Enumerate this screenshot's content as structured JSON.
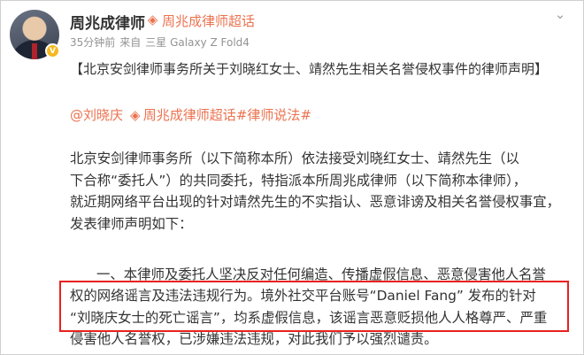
{
  "post": {
    "author": "周兆成律师",
    "topic_icon": "diamond-topic-icon",
    "topic": "周兆成律师超话",
    "time": "35分钟前",
    "source_prefix": "来自",
    "device": "三星 Galaxy Z Fold4",
    "menu_icon": "chevron-down-icon",
    "verified_icon": "v-verified-icon",
    "verified_glyph": "V",
    "title": "【北京安剑律师事务所关于刘晓红女士、靖然先生相关名誉侵权事件的律师声明】",
    "mention": "@刘晓庆",
    "topic2": "周兆成律师超话",
    "hashtag": "#律师说法#",
    "paragraph1": [
      "北京安剑律师事务所（以下简称本所）依法接受刘晓红女士、靖然先生（以",
      "下合称“委托人”）的共同委托，特指派本所周兆成律师（以下简称本律师），",
      "就近期网络平台出现的针对靖然先生的不实指认、恶意诽谤及相关名誉侵权事宜，",
      "发表律师声明如下："
    ],
    "paragraph2": [
      "一、本律师及委托人坚决反对任何编造、传播虚假信息、恶意侵害他人名誉",
      "权的网络谣言及违法违规行为。境外社交平台账号“Daniel Fang” 发布的针对",
      "“刘晓庆女士的死亡谣言”，均系虚假信息，该谣言恶意贬损他人人格尊严、严重",
      "侵害他人名誉权，已涉嫌违法违规，对此我们予以强烈谴责。"
    ]
  },
  "colors": {
    "accent": "#eb7350",
    "highlight_border": "#e8211f",
    "meta": "#939393",
    "verified": "#f6b91f"
  }
}
